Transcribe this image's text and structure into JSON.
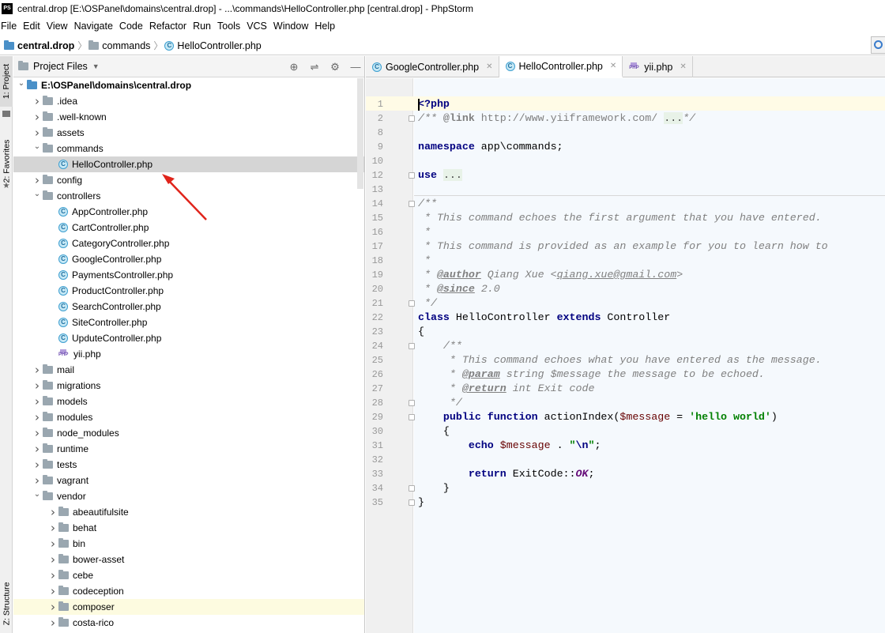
{
  "window": {
    "app_icon_text": "PS",
    "title": "central.drop [E:\\OSPanel\\domains\\central.drop] - ...\\commands\\HelloController.php [central.drop] - PhpStorm"
  },
  "menu": [
    "File",
    "Edit",
    "View",
    "Navigate",
    "Code",
    "Refactor",
    "Run",
    "Tools",
    "VCS",
    "Window",
    "Help"
  ],
  "breadcrumb": {
    "root": "central.drop",
    "folder": "commands",
    "file": "HelloController.php"
  },
  "left_strip": {
    "project_tab": "1: Project",
    "favorites_tab": "2: Favorites",
    "structure_tab": "Z: Structure"
  },
  "project_panel": {
    "header": "Project Files",
    "root": "E:\\OSPanel\\domains\\central.drop",
    "tree": [
      {
        "label": ".idea",
        "type": "folder",
        "depth": 1,
        "state": "closed"
      },
      {
        "label": ".well-known",
        "type": "folder",
        "depth": 1,
        "state": "closed"
      },
      {
        "label": "assets",
        "type": "folder",
        "depth": 1,
        "state": "closed"
      },
      {
        "label": "commands",
        "type": "folder",
        "depth": 1,
        "state": "open"
      },
      {
        "label": "HelloController.php",
        "type": "class",
        "depth": 2,
        "state": "leaf",
        "selected": true
      },
      {
        "label": "config",
        "type": "folder",
        "depth": 1,
        "state": "closed"
      },
      {
        "label": "controllers",
        "type": "folder",
        "depth": 1,
        "state": "open"
      },
      {
        "label": "AppController.php",
        "type": "class",
        "depth": 2,
        "state": "leaf"
      },
      {
        "label": "CartController.php",
        "type": "class",
        "depth": 2,
        "state": "leaf"
      },
      {
        "label": "CategoryController.php",
        "type": "class",
        "depth": 2,
        "state": "leaf"
      },
      {
        "label": "GoogleController.php",
        "type": "class",
        "depth": 2,
        "state": "leaf"
      },
      {
        "label": "PaymentsController.php",
        "type": "class",
        "depth": 2,
        "state": "leaf"
      },
      {
        "label": "ProductController.php",
        "type": "class",
        "depth": 2,
        "state": "leaf"
      },
      {
        "label": "SearchController.php",
        "type": "class",
        "depth": 2,
        "state": "leaf"
      },
      {
        "label": "SiteController.php",
        "type": "class",
        "depth": 2,
        "state": "leaf"
      },
      {
        "label": "UpduteController.php",
        "type": "class",
        "depth": 2,
        "state": "leaf"
      },
      {
        "label": "yii.php",
        "type": "php",
        "depth": 2,
        "state": "leaf"
      },
      {
        "label": "mail",
        "type": "folder",
        "depth": 1,
        "state": "closed"
      },
      {
        "label": "migrations",
        "type": "folder",
        "depth": 1,
        "state": "closed"
      },
      {
        "label": "models",
        "type": "folder",
        "depth": 1,
        "state": "closed"
      },
      {
        "label": "modules",
        "type": "folder",
        "depth": 1,
        "state": "closed"
      },
      {
        "label": "node_modules",
        "type": "folder",
        "depth": 1,
        "state": "closed"
      },
      {
        "label": "runtime",
        "type": "folder",
        "depth": 1,
        "state": "closed"
      },
      {
        "label": "tests",
        "type": "folder",
        "depth": 1,
        "state": "closed"
      },
      {
        "label": "vagrant",
        "type": "folder",
        "depth": 1,
        "state": "closed"
      },
      {
        "label": "vendor",
        "type": "folder",
        "depth": 1,
        "state": "open"
      },
      {
        "label": "abeautifulsite",
        "type": "folder",
        "depth": 2,
        "state": "closed"
      },
      {
        "label": "behat",
        "type": "folder",
        "depth": 2,
        "state": "closed"
      },
      {
        "label": "bin",
        "type": "folder",
        "depth": 2,
        "state": "closed"
      },
      {
        "label": "bower-asset",
        "type": "folder",
        "depth": 2,
        "state": "closed"
      },
      {
        "label": "cebe",
        "type": "folder",
        "depth": 2,
        "state": "closed"
      },
      {
        "label": "codeception",
        "type": "folder",
        "depth": 2,
        "state": "closed"
      },
      {
        "label": "composer",
        "type": "folder",
        "depth": 2,
        "state": "closed",
        "hover": true
      },
      {
        "label": "costa-rico",
        "type": "folder",
        "depth": 2,
        "state": "closed"
      }
    ]
  },
  "tabs": [
    {
      "label": "GoogleController.php",
      "icon": "class",
      "active": false
    },
    {
      "label": "HelloController.php",
      "icon": "class",
      "active": true
    },
    {
      "label": "yii.php",
      "icon": "php",
      "active": false
    }
  ],
  "editor": {
    "line_numbers": [
      "1",
      "2",
      "8",
      "9",
      "10",
      "12",
      "13",
      "14",
      "15",
      "16",
      "17",
      "18",
      "19",
      "20",
      "21",
      "22",
      "23",
      "24",
      "25",
      "26",
      "27",
      "28",
      "29",
      "30",
      "31",
      "32",
      "33",
      "34",
      "35"
    ]
  },
  "colors": {
    "keyword": "#000080",
    "comment": "#808080",
    "string": "#008000",
    "variable": "#660000",
    "arrow": "#e0241b"
  }
}
